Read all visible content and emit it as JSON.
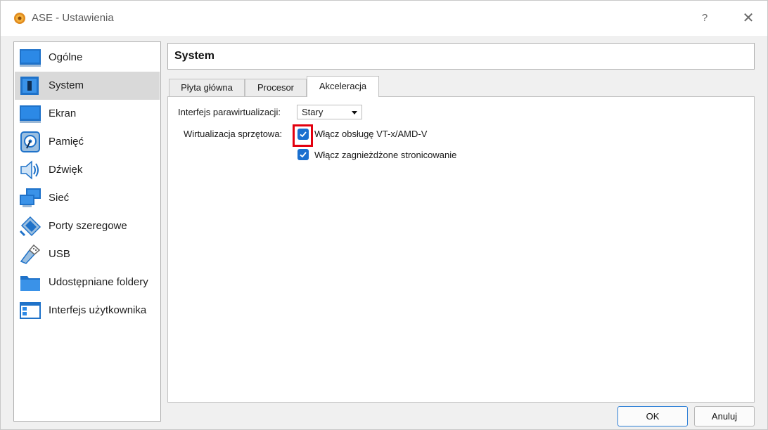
{
  "window": {
    "title": "ASE - Ustawienia",
    "help_symbol": "?",
    "close_symbol": "✕",
    "app_icon": "virtualbox-gear-icon"
  },
  "sidebar": {
    "items": [
      {
        "label": "Ogólne",
        "icon": "general-monitor-icon",
        "selected": false
      },
      {
        "label": "System",
        "icon": "system-chip-icon",
        "selected": true
      },
      {
        "label": "Ekran",
        "icon": "display-icon",
        "selected": false
      },
      {
        "label": "Pamięć",
        "icon": "storage-disk-icon",
        "selected": false
      },
      {
        "label": "Dźwięk",
        "icon": "audio-speaker-icon",
        "selected": false
      },
      {
        "label": "Sieć",
        "icon": "network-icon",
        "selected": false
      },
      {
        "label": "Porty szeregowe",
        "icon": "serial-port-icon",
        "selected": false
      },
      {
        "label": "USB",
        "icon": "usb-icon",
        "selected": false
      },
      {
        "label": "Udostępniane foldery",
        "icon": "shared-folder-icon",
        "selected": false
      },
      {
        "label": "Interfejs użytkownika",
        "icon": "user-interface-icon",
        "selected": false
      }
    ]
  },
  "header": {
    "title": "System"
  },
  "tabs": [
    {
      "label": "Płyta główna",
      "active": false
    },
    {
      "label": "Procesor",
      "active": false
    },
    {
      "label": "Akceleracja",
      "active": true
    }
  ],
  "acceleration": {
    "paravirt_label": "Interfejs parawirtualizacji:",
    "paravirt_value": "Stary",
    "hwvirt_label": "Wirtualizacja sprzętowa:",
    "vtx_label": "Włącz obsługę VT-x/AMD-V",
    "vtx_checked": true,
    "nested_label": "Włącz zagnieżdżone stronicowanie",
    "nested_checked": true
  },
  "buttons": {
    "ok": "OK",
    "cancel": "Anuluj"
  },
  "colors": {
    "checkbox": "#1a6fcf",
    "highlight": "#e3000f",
    "selected_item": "#d9d9d9"
  }
}
